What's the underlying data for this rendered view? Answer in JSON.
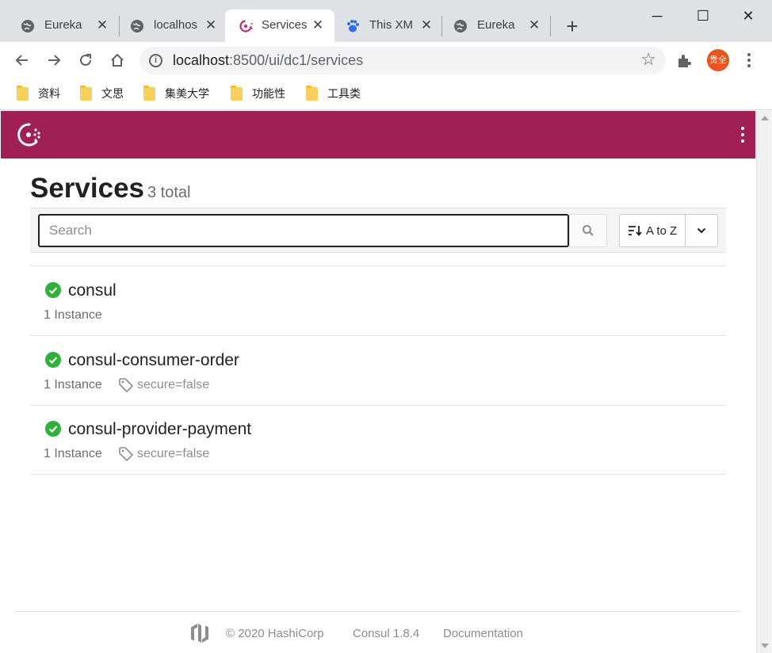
{
  "browser": {
    "tabs": [
      {
        "title": "Eureka",
        "favicon": "globe-icon"
      },
      {
        "title": "localhos",
        "favicon": "globe-icon"
      },
      {
        "title": "Services",
        "favicon": "consul-icon",
        "active": true
      },
      {
        "title": "This XM",
        "favicon": "baidu-paw-icon"
      },
      {
        "title": "Eureka",
        "favicon": "globe-icon"
      }
    ],
    "url_host": "localhost",
    "url_path": ":8500/ui/dc1/services",
    "avatar_text": "贵全",
    "bookmarks": [
      "资料",
      "文思",
      "集美大学",
      "功能性",
      "工具类"
    ]
  },
  "app": {
    "brand_color": "#a01f55",
    "page_title": "Services",
    "total_text": "3 total",
    "search_placeholder": "Search",
    "sort_label": "A to Z",
    "services": [
      {
        "name": "consul",
        "instances": "1 Instance",
        "tag": "",
        "status": "passing"
      },
      {
        "name": "consul-consumer-order",
        "instances": "1 Instance",
        "tag": "secure=false",
        "status": "passing"
      },
      {
        "name": "consul-provider-payment",
        "instances": "1 Instance",
        "tag": "secure=false",
        "status": "passing"
      }
    ],
    "footer": {
      "copyright": "© 2020 HashiCorp",
      "version": "Consul 1.8.4",
      "docs": "Documentation"
    }
  }
}
